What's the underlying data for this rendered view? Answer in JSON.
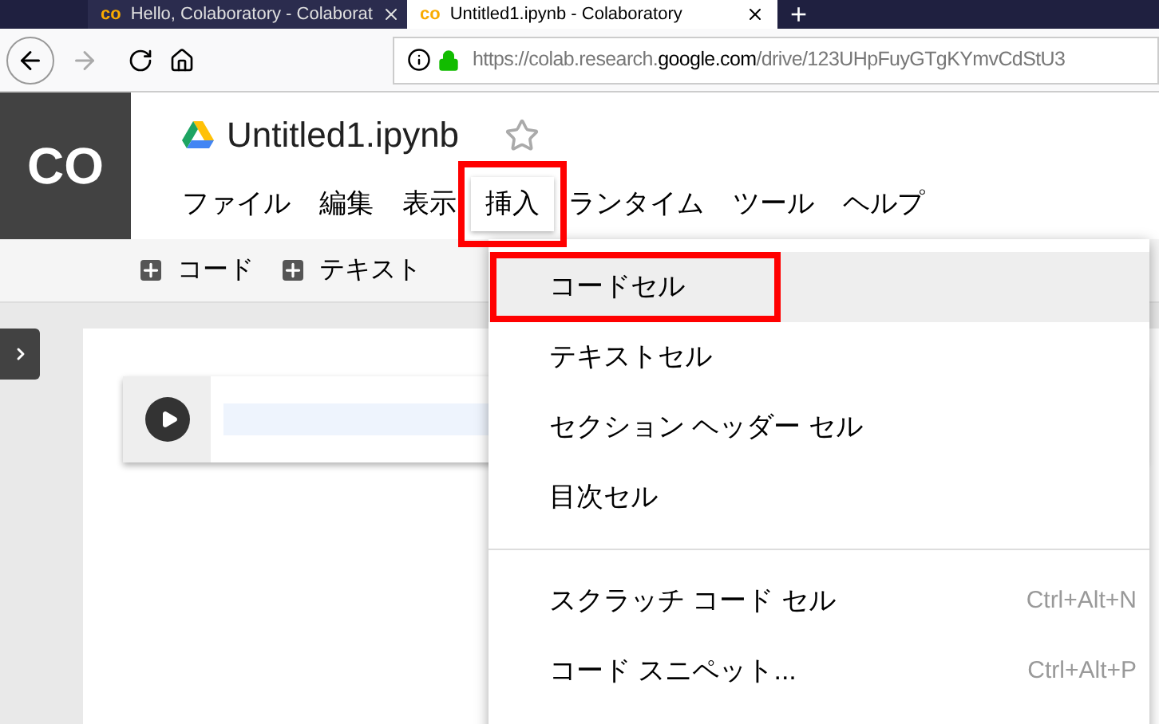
{
  "browser": {
    "tabs": [
      {
        "logo": "co",
        "title": "Hello, Colaboratory - Colaborat",
        "selected": false
      },
      {
        "logo": "co",
        "title": "Untitled1.ipynb - Colaboratory",
        "selected": true
      }
    ],
    "new_tab": "+",
    "url": {
      "prefix": "https://colab.research.",
      "domain": "google.com",
      "path": "/drive/123UHpFuyGTgKYmvCdStU3"
    }
  },
  "app": {
    "logo": "CO",
    "title": "Untitled1.ipynb",
    "starred": false,
    "menu": [
      {
        "label": "ファイル",
        "selected": false,
        "annotated": false
      },
      {
        "label": "編集",
        "selected": false,
        "annotated": false
      },
      {
        "label": "表示",
        "selected": false,
        "annotated": false
      },
      {
        "label": "挿入",
        "selected": true,
        "annotated": true
      },
      {
        "label": "ランタイム",
        "selected": false,
        "annotated": false
      },
      {
        "label": "ツール",
        "selected": false,
        "annotated": false
      },
      {
        "label": "ヘルプ",
        "selected": false,
        "annotated": false
      }
    ],
    "toolbar": [
      {
        "label": "コード"
      },
      {
        "label": "テキスト"
      }
    ]
  },
  "dropdown": {
    "items": [
      {
        "kind": "item",
        "label": "コードセル",
        "highlighted": true,
        "annotated": true
      },
      {
        "kind": "item",
        "label": "テキストセル",
        "highlighted": false,
        "annotated": false
      },
      {
        "kind": "item",
        "label": "セクション ヘッダー セル",
        "highlighted": false,
        "annotated": false
      },
      {
        "kind": "item",
        "label": "目次セル",
        "highlighted": false,
        "annotated": false
      },
      {
        "kind": "divider"
      },
      {
        "kind": "item",
        "label": "スクラッチ コード セル",
        "shortcut": "Ctrl+Alt+N",
        "highlighted": false,
        "annotated": false
      },
      {
        "kind": "item",
        "label": "コード スニペット...",
        "shortcut": "Ctrl+Alt+P",
        "highlighted": false,
        "annotated": false
      }
    ]
  }
}
